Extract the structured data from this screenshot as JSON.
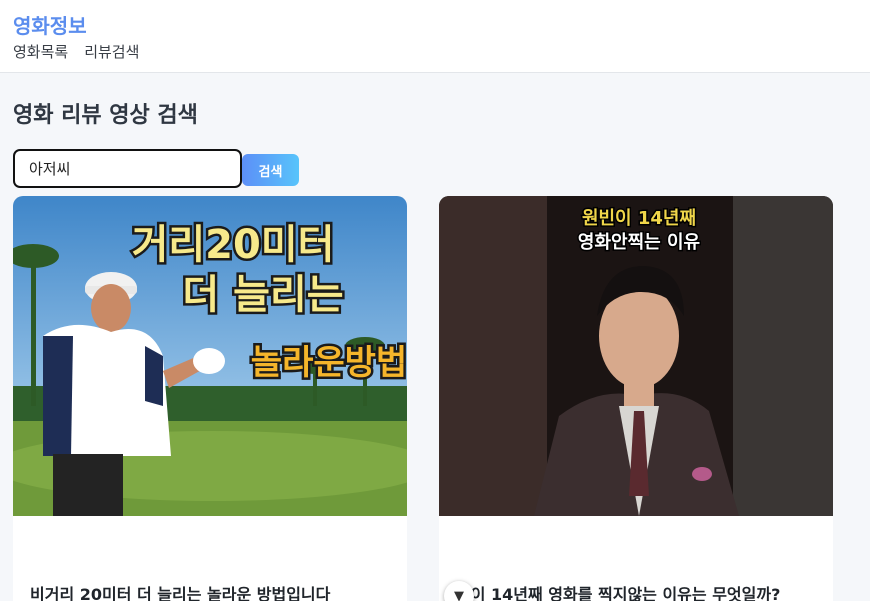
{
  "app": {
    "brand": "영화정보"
  },
  "nav": {
    "items": [
      {
        "label": "영화목록"
      },
      {
        "label": "리뷰검색"
      }
    ]
  },
  "page": {
    "title": "영화 리뷰 영상 검색"
  },
  "search": {
    "value": "아저씨",
    "button_label": "검색"
  },
  "cards": [
    {
      "thumbnail_text": [
        "거리20미터",
        "더 늘리는",
        "놀라운방법"
      ],
      "title": "비거리 20미터 더 늘리는 놀라운 방법입니다"
    },
    {
      "thumbnail_text": [
        "원빈이 14년째",
        "영화안찍는 이유"
      ],
      "title": "빈이 14년째 영화를 찍지않는 이유는 무엇일까?"
    }
  ],
  "scroll_button": {
    "icon": "chevron-down-icon"
  },
  "colors": {
    "brand": "#5b8dee",
    "button_gradient_start": "#5c8ff7",
    "button_gradient_end": "#58c4fb"
  }
}
